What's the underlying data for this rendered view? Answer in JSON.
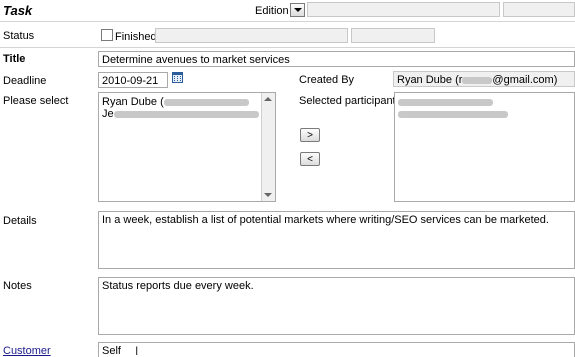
{
  "header": {
    "title": "Task",
    "edition_label": "Edition"
  },
  "status": {
    "label": "Status",
    "finished_label": "Finished"
  },
  "title_field": {
    "label": "Title",
    "value": "Determine avenues to market services"
  },
  "deadline": {
    "label": "Deadline",
    "value": "2010-09-21"
  },
  "created_by": {
    "label": "Created By",
    "value_prefix": "Ryan Dube (r",
    "value_suffix": "@gmail.com)"
  },
  "please_select": {
    "label": "Please select",
    "item1_prefix": "Ryan Dube (",
    "item2_prefix": "Je"
  },
  "selected_participants": {
    "label": "Selected participants"
  },
  "move_buttons": {
    "add_label": ">",
    "remove_label": "<"
  },
  "details": {
    "label": "Details",
    "value": "In a week, establish a list of potential markets where writing/SEO services can be marketed."
  },
  "notes": {
    "label": "Notes",
    "value": "Status reports due every week."
  },
  "customer": {
    "label": "Customer",
    "value": "Self"
  },
  "colors": {
    "link": "#1a1a8c",
    "border": "#a9a9a9",
    "disabled_bg": "#f0f0f0"
  }
}
